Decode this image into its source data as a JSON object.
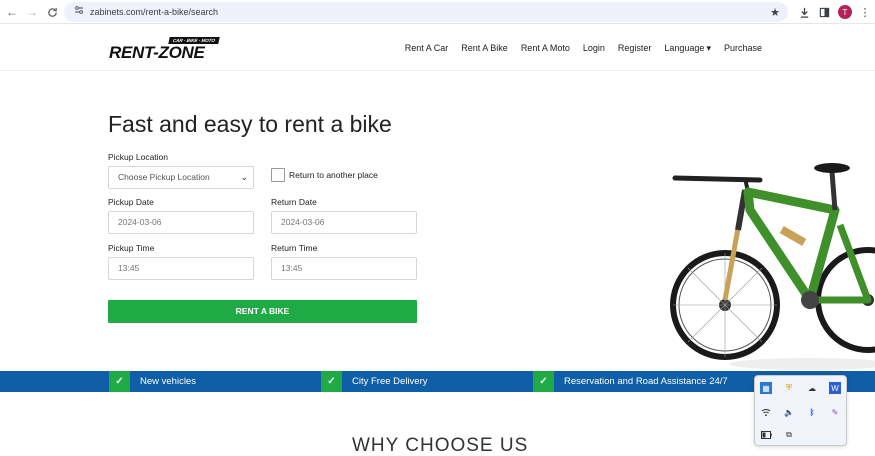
{
  "browser": {
    "url": "zabinets.com/rent-a-bike/search",
    "back_icon": "←",
    "forward_icon": "→",
    "reload_icon": "C",
    "avatar_letter": "T"
  },
  "site": {
    "logo_text": "RENT-ZONE",
    "logo_tagline": "CAR · BIKE · MOTO",
    "menu": [
      {
        "label": "Rent A Car"
      },
      {
        "label": "Rent A Bike"
      },
      {
        "label": "Rent A Moto"
      },
      {
        "label": "Login"
      },
      {
        "label": "Register"
      },
      {
        "label": "Language"
      },
      {
        "label": "Purchase"
      }
    ]
  },
  "form": {
    "title": "Fast and easy to rent a bike",
    "pickup_location_label": "Pickup Location",
    "pickup_location_value": "Choose Pickup Location",
    "return_other_label": "Return to another place",
    "pickup_date_label": "Pickup Date",
    "pickup_date_value": "2024-03-06",
    "return_date_label": "Return Date",
    "return_date_value": "2024-03-06",
    "pickup_time_label": "Pickup Time",
    "pickup_time_value": "13:45",
    "return_time_label": "Return Time",
    "return_time_value": "13:45",
    "submit_label": "RENT A BIKE"
  },
  "features": [
    {
      "label": "New vehicles"
    },
    {
      "label": "City Free Delivery"
    },
    {
      "label": "Reservation and Road Assistance 24/7"
    }
  ],
  "section_heading": "WHY CHOOSE US",
  "colors": {
    "accent_green": "#1faa45",
    "feature_blue": "#0f5ea8",
    "bike_green": "#3f8f2a"
  }
}
